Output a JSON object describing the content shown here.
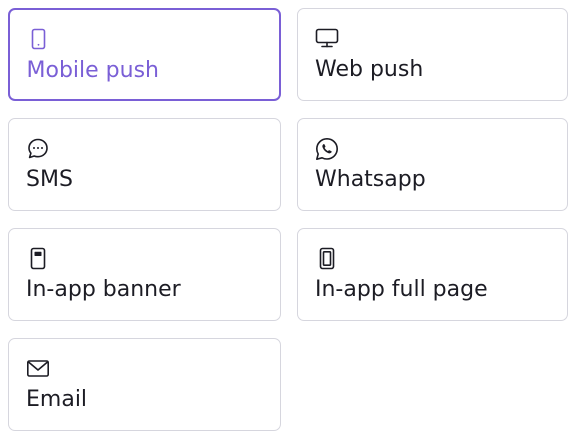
{
  "channels": [
    {
      "label": "Mobile push",
      "icon": "mobile-phone-icon",
      "selected": true
    },
    {
      "label": "Web push",
      "icon": "desktop-monitor-icon",
      "selected": false
    },
    {
      "label": "SMS",
      "icon": "chat-bubble-icon",
      "selected": false
    },
    {
      "label": "Whatsapp",
      "icon": "whatsapp-icon",
      "selected": false
    },
    {
      "label": "In-app banner",
      "icon": "in-app-banner-icon",
      "selected": false
    },
    {
      "label": "In-app full page",
      "icon": "in-app-full-page-icon",
      "selected": false
    },
    {
      "label": "Email",
      "icon": "envelope-icon",
      "selected": false
    }
  ],
  "colors": {
    "accent": "#7a5fd6",
    "text": "#1c1c24",
    "border": "#d6d6de"
  }
}
